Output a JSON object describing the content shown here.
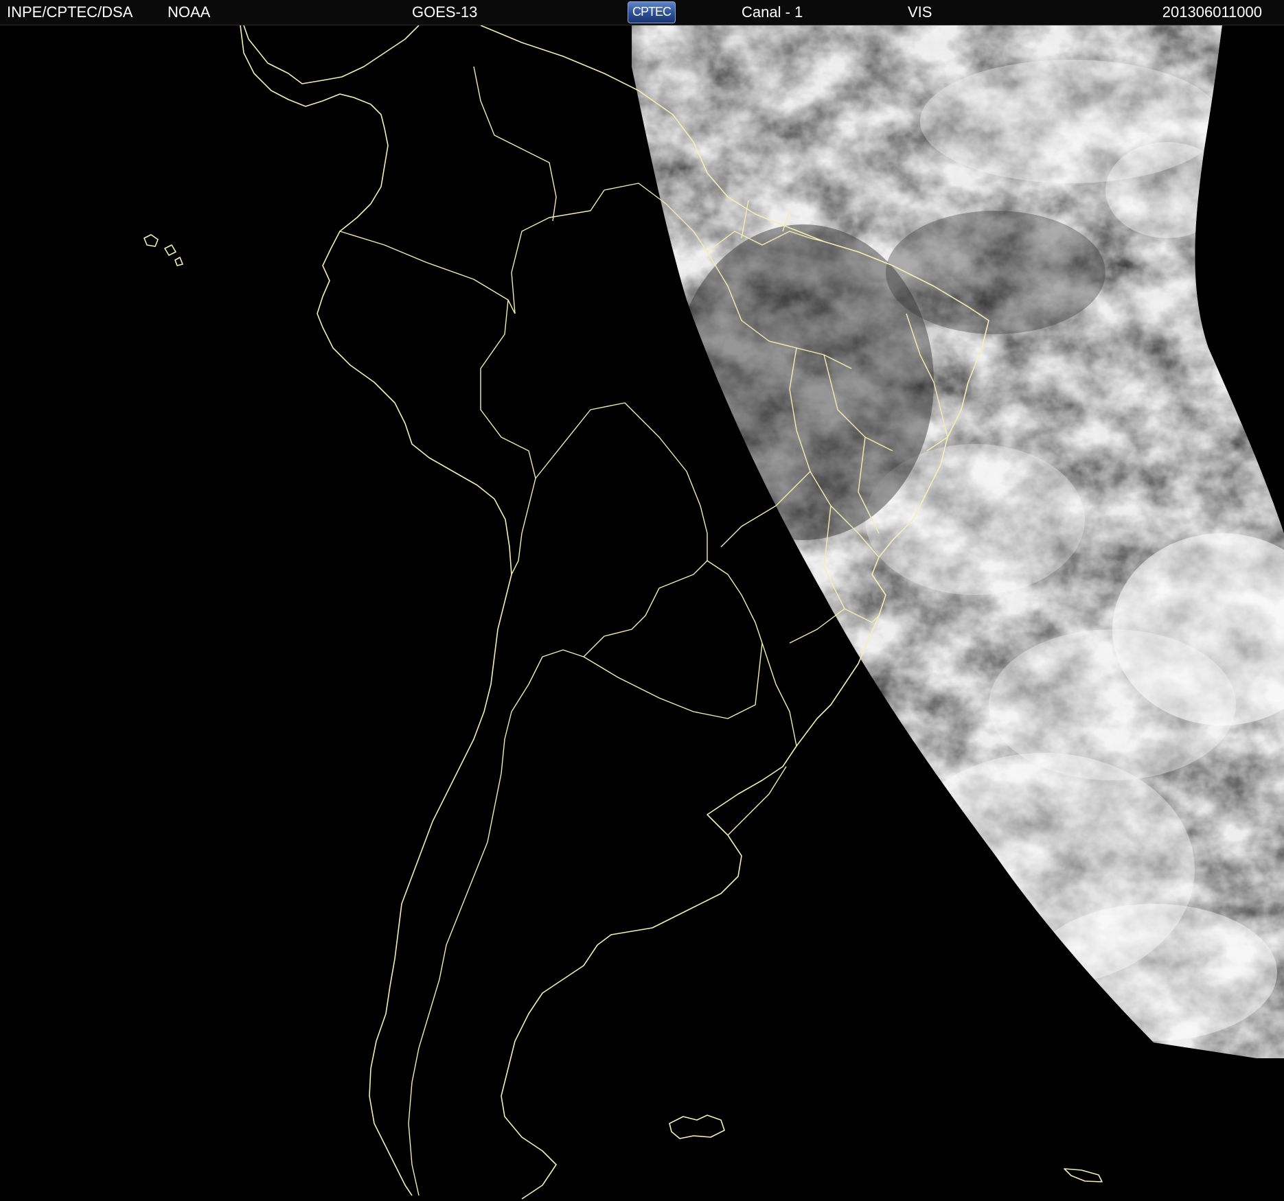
{
  "header": {
    "organization": "INPE/CPTEC/DSA",
    "agency": "NOAA",
    "satellite": "GOES-13",
    "logo_text": "CPTEC",
    "channel": "Canal - 1",
    "band": "VIS",
    "timestamp": "201306011000"
  },
  "colors": {
    "background": "#000000",
    "header_background": "#0a0a0a",
    "header_text": "#ffffff",
    "map_lines": "#f2efb0",
    "cloud_dark": "#3a3a3a",
    "cloud_bright": "#f4f4f4"
  }
}
